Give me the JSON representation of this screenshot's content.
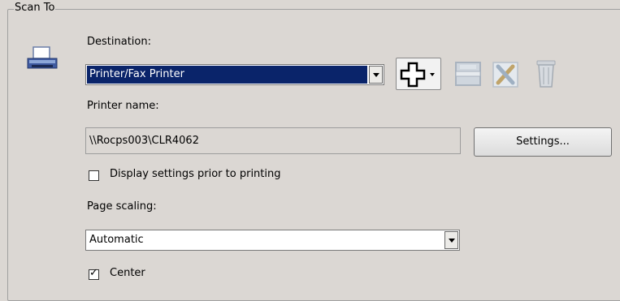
{
  "group_title": "Scan To",
  "destination": {
    "label": "Destination:",
    "value": "Printer/Fax Printer"
  },
  "toolbar": {
    "add_icon": "add-icon",
    "edit_icon": "edit-icon",
    "properties_icon": "tools-icon",
    "delete_icon": "trash-icon"
  },
  "printer": {
    "label": "Printer name:",
    "value": "\\\\Rocps003\\CLR4062",
    "settings_label": "Settings..."
  },
  "display_settings": {
    "label": "Display settings prior to printing",
    "checked": false
  },
  "page_scaling": {
    "label": "Page scaling:",
    "value": "Automatic"
  },
  "center": {
    "label": "Center",
    "checked": true
  },
  "colors": {
    "selection": "#0a246a",
    "background": "#dbd7d3"
  }
}
